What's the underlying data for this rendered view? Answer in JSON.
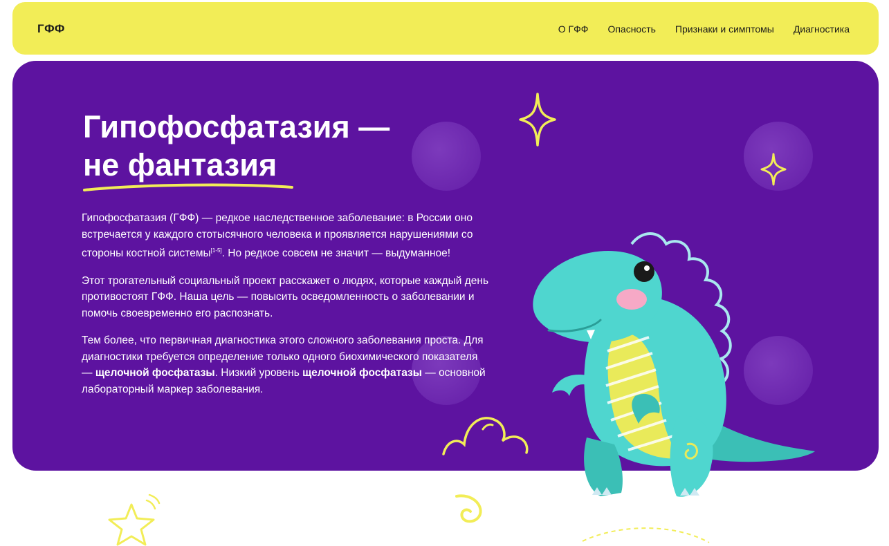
{
  "header": {
    "logo": "ГФФ",
    "nav": [
      "О ГФФ",
      "Опасность",
      "Признаки и симптомы",
      "Диагностика"
    ]
  },
  "hero": {
    "title_line1": "Гипофосфатазия —",
    "title_line2": "не фантазия",
    "p1_a": "Гипофосфатазия (ГФФ) — редкое наследственное заболевание: в России оно встречается у каждого стотысячного человека и проявляется нарушениями со стороны костной системы",
    "p1_ref": "[1-5]",
    "p1_b": ". Но редкое совсем не значит — выдуманное!",
    "p2": "Этот трогательный социальный проект расскажет о людях, которые каждый день противостоят ГФФ. Наша цель — повысить осведомленность о заболевании и помочь своевременно его распознать.",
    "p3_a": "Тем более, что первичная диагностика этого сложного заболевания проста. Для диагностики требуется определение только одного биохимического показателя — ",
    "p3_b1": "щелочной фосфатазы",
    "p3_c": ". Низкий уровень ",
    "p3_b2": "щелочной фосфатазы",
    "p3_d": " — основной лабораторный маркер заболевания."
  },
  "colors": {
    "yellow": "#f2ed57",
    "purple": "#5d13a0",
    "dino": "#4fd6cf",
    "dino_dark": "#3bbfb6"
  },
  "icons": [
    "sparkle-icon",
    "star-icon",
    "swirl-icon",
    "cloud-doodle-icon"
  ]
}
